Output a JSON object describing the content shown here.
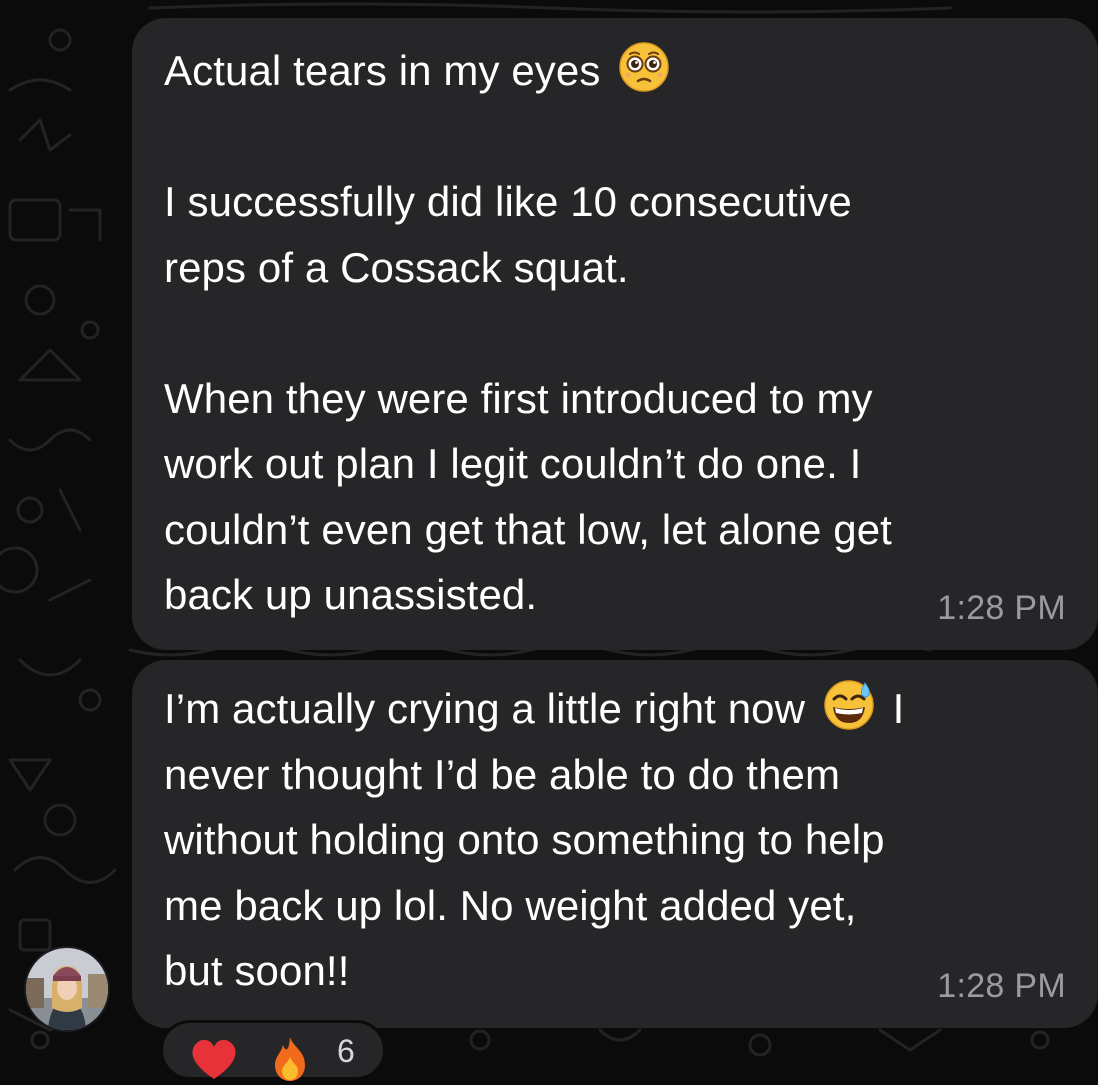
{
  "messages": [
    {
      "line1_before_emoji": "Actual tears in my eyes ",
      "emoji_1": "face-holding-back-tears",
      "paragraph_2": "I successfully did like 10 consecutive\nreps of a Cossack squat.",
      "paragraph_3": "When they were first introduced to my\nwork out plan I legit couldn’t do one. I\ncouldn’t even get that low, let alone get\nback up unassisted.",
      "time": "1:28 PM"
    },
    {
      "text_before_emoji": "I’m actually crying a little right now ",
      "emoji_1": "grinning-face-with-sweat",
      "text_after_emoji": " I\nnever thought I’d be able to do them\nwithout holding onto something to help\nme back up lol. No weight added yet,\nbut soon!!",
      "time": "1:28 PM"
    }
  ],
  "reactions": {
    "icons": [
      "red-heart",
      "fire"
    ],
    "count": "6"
  },
  "colors": {
    "background": "#0b0b0c",
    "bubble": "#262628",
    "text": "#ffffff",
    "timestamp": "#9b9b9f"
  }
}
